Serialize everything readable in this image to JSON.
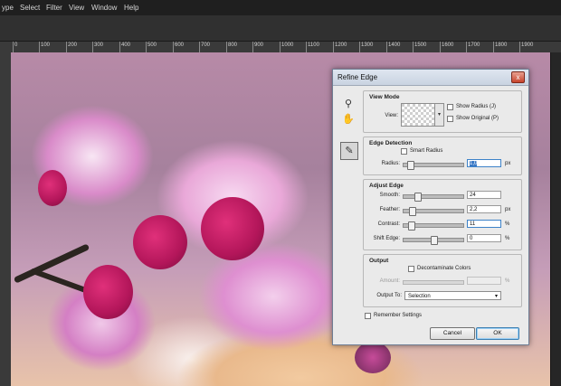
{
  "menubar": {
    "items": [
      "ype",
      "Select",
      "Filter",
      "View",
      "Window",
      "Help"
    ]
  },
  "ruler": {
    "labels": [
      "0",
      "100",
      "200",
      "300",
      "400",
      "500",
      "600",
      "700",
      "800",
      "900",
      "1000",
      "1100",
      "1200",
      "1300",
      "1400",
      "1500",
      "1600",
      "1700",
      "1800",
      "1900"
    ]
  },
  "dialog": {
    "title": "Refine Edge",
    "close": "x",
    "tools": {
      "zoom": "⚲",
      "hand": "✋",
      "brush": "✎"
    },
    "view_mode": {
      "title": "View Mode",
      "view_label": "View:",
      "show_radius": "Show Radius (J)",
      "show_original": "Show Original (P)"
    },
    "edge_detection": {
      "title": "Edge Detection",
      "smart_radius": "Smart Radius",
      "radius_label": "Radius:",
      "radius_value": "1,0",
      "radius_unit": "px",
      "radius_level": 0.05
    },
    "adjust_edge": {
      "title": "Adjust Edge",
      "smooth_label": "Smooth:",
      "smooth_value": "24",
      "feather_label": "Feather:",
      "feather_value": "2,2",
      "feather_unit": "px",
      "contrast_label": "Contrast:",
      "contrast_value": "11",
      "contrast_unit": "%",
      "shift_label": "Shift Edge:",
      "shift_value": "0",
      "shift_unit": "%"
    },
    "output": {
      "title": "Output",
      "decontaminate": "Decontaminate Colors",
      "amount_label": "Amount:",
      "amount_unit": "%",
      "output_to_label": "Output To:",
      "output_to_value": "Selection"
    },
    "remember": "Remember Settings",
    "cancel": "Cancel",
    "ok": "OK"
  }
}
